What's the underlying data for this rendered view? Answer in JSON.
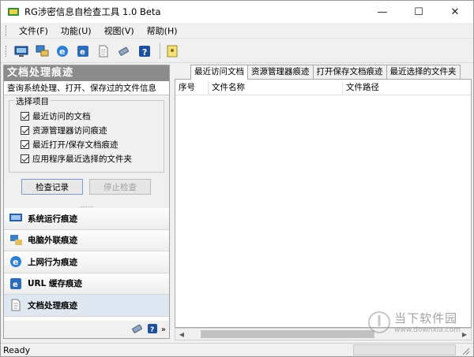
{
  "window": {
    "title": "RG涉密信息自检查工具 1.0 Beta"
  },
  "menu": [
    "文件(F)",
    "功能(U)",
    "视图(V)",
    "帮助(H)"
  ],
  "toolbar_icons": [
    "monitor-icon",
    "network-computer-icon",
    "ie-browser-icon",
    "url-cache-icon",
    "document-icon",
    "usb-drive-icon",
    "help-icon",
    "exit-icon"
  ],
  "left_panel": {
    "title": "文档处理痕迹",
    "subtitle": "查询系统处理、打开、保存过的文件信息",
    "group_label": "选择项目",
    "options": [
      {
        "label": "最近访问的文档",
        "checked": true
      },
      {
        "label": "资源管理器访问痕迹",
        "checked": true
      },
      {
        "label": "最近打开/保存文档痕迹",
        "checked": true
      },
      {
        "label": "应用程序最近选择的文件夹",
        "checked": true
      }
    ],
    "check_button": "检查记录",
    "stop_button": "停止检查",
    "splitter": "........."
  },
  "nav": [
    {
      "label": "系统运行痕迹",
      "icon": "monitor-icon",
      "selected": false
    },
    {
      "label": "电脑外联痕迹",
      "icon": "network-computer-icon",
      "selected": false
    },
    {
      "label": "上网行为痕迹",
      "icon": "ie-browser-icon",
      "selected": false
    },
    {
      "label": "URL 缓存痕迹",
      "icon": "url-cache-icon",
      "selected": false
    },
    {
      "label": "文档处理痕迹",
      "icon": "document-icon",
      "selected": true
    }
  ],
  "tabs": [
    "最近访问文档",
    "资源管理器痕迹",
    "打开保存文档痕迹",
    "最近选择的文件夹"
  ],
  "active_tab": 0,
  "columns": [
    "序号",
    "文件名称",
    "文件路径"
  ],
  "status": {
    "text": "Ready"
  },
  "watermark": {
    "brand": "当下软件园",
    "url": "www.downxia.com"
  },
  "colors": {
    "panel_header": "#8c8c8c",
    "selected_nav": "#dfe8f2",
    "accent": "#1c5fb0"
  }
}
